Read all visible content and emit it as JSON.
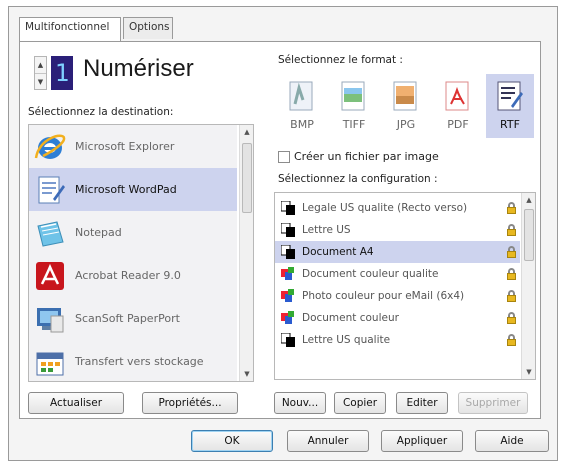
{
  "tabs": [
    {
      "label": "Multifonctionnel",
      "active": true
    },
    {
      "label": "Options",
      "active": false
    }
  ],
  "scan": {
    "number": "1",
    "label": "Numériser"
  },
  "destination": {
    "heading": "Sélectionnez la destination:",
    "items": [
      {
        "label": "Microsoft Explorer",
        "icon": "internet-explorer-icon",
        "selected": false
      },
      {
        "label": "Microsoft WordPad",
        "icon": "wordpad-icon",
        "selected": true
      },
      {
        "label": "Notepad",
        "icon": "notepad-icon",
        "selected": false
      },
      {
        "label": "Acrobat Reader 9.0",
        "icon": "acrobat-reader-icon",
        "selected": false
      },
      {
        "label": "ScanSoft PaperPort",
        "icon": "paperport-icon",
        "selected": false
      },
      {
        "label": "Transfert vers stockage",
        "icon": "storage-transfer-icon",
        "selected": false
      }
    ]
  },
  "format": {
    "heading": "Sélectionnez le format :",
    "items": [
      {
        "label": "BMP",
        "icon": "bmp-icon",
        "selected": false
      },
      {
        "label": "TIFF",
        "icon": "tiff-icon",
        "selected": false
      },
      {
        "label": "JPG",
        "icon": "jpg-icon",
        "selected": false
      },
      {
        "label": "PDF",
        "icon": "pdf-icon",
        "selected": false
      },
      {
        "label": "RTF",
        "icon": "rtf-icon",
        "selected": true
      }
    ],
    "checkbox_label": "Créer un fichier par image",
    "checkbox_checked": false
  },
  "configuration": {
    "heading": "Sélectionnez la configuration :",
    "items": [
      {
        "label": "Legale US qualite (Recto verso)",
        "icon": "bw-document-icon",
        "selected": false
      },
      {
        "label": "Lettre US",
        "icon": "bw-document-icon",
        "selected": false
      },
      {
        "label": "Document A4",
        "icon": "bw-document-icon",
        "selected": true
      },
      {
        "label": "Document couleur qualite",
        "icon": "color-document-icon",
        "selected": false
      },
      {
        "label": "Photo couleur pour eMail (6x4)",
        "icon": "color-document-icon",
        "selected": false
      },
      {
        "label": "Document couleur",
        "icon": "color-document-icon",
        "selected": false
      },
      {
        "label": "Lettre US qualite",
        "icon": "bw-document-icon",
        "selected": false
      }
    ]
  },
  "left_buttons": {
    "refresh": "Actualiser",
    "properties": "Propriétés..."
  },
  "config_buttons": {
    "new": "Nouv...",
    "copy": "Copier",
    "edit": "Editer",
    "delete": "Supprimer"
  },
  "dialog_buttons": {
    "ok": "OK",
    "cancel": "Annuler",
    "apply": "Appliquer",
    "help": "Aide"
  },
  "colors": {
    "selection": "#cdd3ee",
    "accent": "#2a1f78"
  }
}
